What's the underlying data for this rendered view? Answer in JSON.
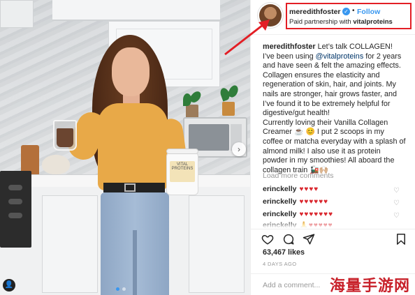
{
  "post": {
    "username": "meredithfoster",
    "separator": "•",
    "follow_label": "Follow",
    "paid_prefix": "Paid partnership with",
    "partner": "vitalproteins",
    "caption_user": "meredithfoster",
    "caption_lines": [
      " Let’s talk COLLAGEN!",
      "I’ve been using ",
      "@vitalproteins",
      " for 2 years and have seen & felt the amazing effects. Collagen ensures the elasticity and regeneration of skin, hair, and joints. My nails are stronger, hair grows faster, and I’ve found it to be extremely helpful for digestive/gut health!",
      "Currently loving their Vanilla Collagen Creamer ☕ 😊 I put 2 scoops in my coffee or matcha everyday with a splash of almond milk! I also use it as protein powder in my smoothies! All aboard the collagen train 🚂🙌🏼"
    ],
    "load_more": "Load more comments",
    "comments": [
      {
        "user": "erinckelly",
        "text": "♥♥♥♥"
      },
      {
        "user": "erinckelly",
        "text": "♥♥♥♥♥♥"
      },
      {
        "user": "erinckelly",
        "text": "♥♥♥♥♥♥♥"
      },
      {
        "user": "erinckelly",
        "text": "🙏♥♥♥♥♥"
      }
    ],
    "likes": "63,467 likes",
    "time_ago": "4 DAYS AGO",
    "add_comment_placeholder": "Add a comment...",
    "more_label": "•••"
  },
  "photo": {
    "jar_label": "VITAL PROTEINS",
    "carousel_next": "›",
    "user_tag": "👤"
  },
  "watermark": "海量手游网",
  "colors": {
    "accent": "#3897f0",
    "highlight_box": "#e31e25",
    "heart": "#d9262d",
    "watermark": "#c8212a"
  }
}
